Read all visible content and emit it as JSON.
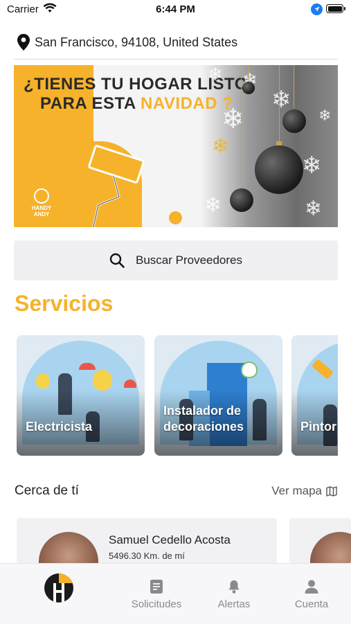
{
  "status_bar": {
    "carrier": "Carrier",
    "time": "6:44 PM"
  },
  "location": {
    "address": "San Francisco, 94108, United States",
    "icon": "map-pin-icon"
  },
  "banner": {
    "headline_line1": "¿TIENES TU HOGAR  LISTO",
    "headline_line2_prefix": "PARA ESTA ",
    "headline_line2_highlight": "NAVIDAD ?",
    "brand_line1": "HANDY",
    "brand_line2": "ANDY",
    "carousel_pages": 1,
    "carousel_active": 1
  },
  "search": {
    "label": "Buscar Proveedores",
    "icon": "search-icon"
  },
  "services_section": {
    "title": "Servicios",
    "items": [
      {
        "label": "Electricista"
      },
      {
        "label": "Instalador de decoraciones"
      },
      {
        "label": "Pintor"
      }
    ]
  },
  "nearby": {
    "title": "Cerca de tí",
    "map_link": "Ver mapa",
    "map_icon": "map-icon",
    "providers": [
      {
        "name": "Samuel Cedello Acosta",
        "distance": "5496.30 Km. de mí"
      },
      {
        "name": "",
        "distance": ""
      }
    ]
  },
  "tabbar": {
    "items": [
      {
        "label": "",
        "icon": "handy-andy-logo-icon",
        "active": true
      },
      {
        "label": "Solicitudes",
        "icon": "document-icon"
      },
      {
        "label": "Alertas",
        "icon": "bell-icon"
      },
      {
        "label": "Cuenta",
        "icon": "user-icon"
      }
    ]
  },
  "colors": {
    "accent": "#f6b22a",
    "tab_inactive": "#8a8a8e",
    "search_bg": "#f0f0f3"
  }
}
